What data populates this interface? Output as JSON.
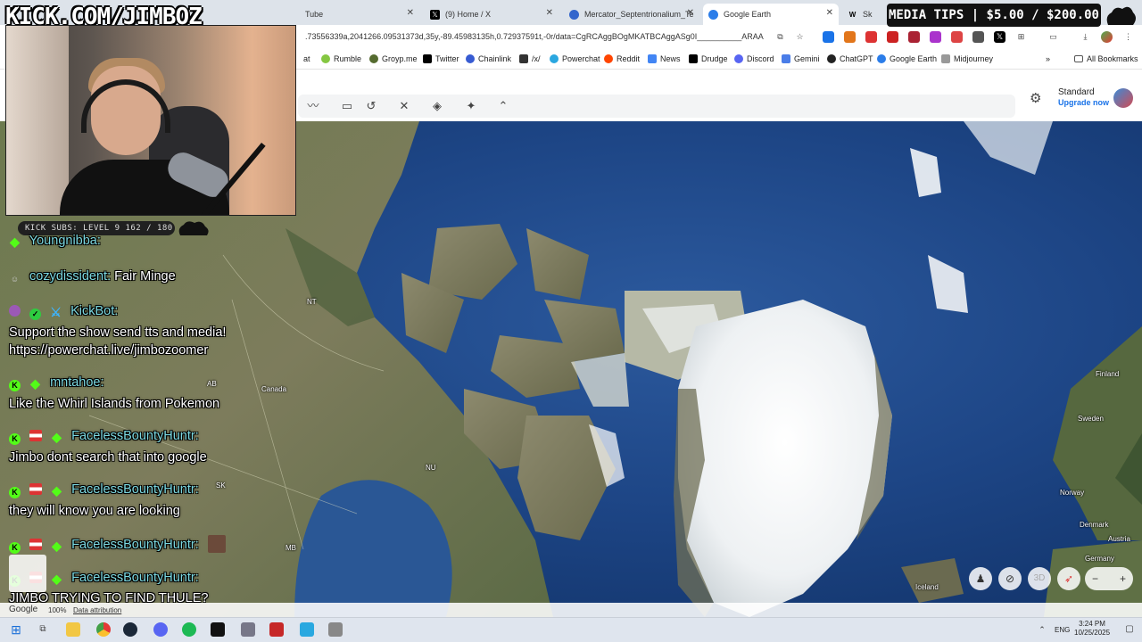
{
  "stream": {
    "logo_text": "KICK.COM/JIMBOZ",
    "subs_bar": "KICK SUBS: LEVEL 9 162 / 180",
    "media_tips": "MEDIA TIPS | $5.00 / $200.00"
  },
  "browser": {
    "tabs": [
      {
        "title": "Tube",
        "active": false
      },
      {
        "title": "(9) Home / X",
        "active": false
      },
      {
        "title": "Mercator_Septentrionalium_Te",
        "active": false
      },
      {
        "title": "Google Earth",
        "active": true
      },
      {
        "title": "Sk",
        "active": false
      }
    ],
    "url": ".73556339a,2041266.09531373d,35y,-89.45983135h,0.72937591t,-0r/data=CgRCAggBOgMKATBCAggASg0I__________ARAA",
    "bookmarks": [
      "at",
      "Rumble",
      "Groyp.me",
      "Twitter",
      "Chainlink",
      "/x/",
      "Powerchat",
      "Reddit",
      "News",
      "Drudge",
      "Discord",
      "Gemini",
      "ChatGPT",
      "Google Earth",
      "Midjourney"
    ],
    "all_bookmarks": "All Bookmarks"
  },
  "earth": {
    "map_style": "Standard",
    "upgrade": "Upgrade now",
    "labels": [
      {
        "text": "Canada"
      },
      {
        "text": "NT"
      },
      {
        "text": "AB"
      },
      {
        "text": "SK"
      },
      {
        "text": "MB"
      },
      {
        "text": "NU"
      },
      {
        "text": "Finland"
      },
      {
        "text": "Sweden"
      },
      {
        "text": "Norway"
      },
      {
        "text": "Denmark"
      },
      {
        "text": "Austria"
      },
      {
        "text": "Germany"
      },
      {
        "text": "Iceland"
      }
    ],
    "btn_3d": "3D",
    "attribution_logo": "Google",
    "zoom_level": "100%",
    "data_attribution": "Data attribution"
  },
  "chat": [
    {
      "user": "Youngnibba:",
      "message": ""
    },
    {
      "user": "cozydissident:",
      "message": "Fair Minge"
    },
    {
      "user": "KickBot:",
      "message": "Support the show send tts and media!"
    },
    {
      "user": "",
      "message": "https://powerchat.live/jimbozoomer"
    },
    {
      "user": "mntahoe:",
      "message": ""
    },
    {
      "user": "",
      "message": "Like the Whirl Islands from Pokemon"
    },
    {
      "user": "FacelessBountyHuntr:",
      "message": ""
    },
    {
      "user": "",
      "message": "Jimbo dont search that into google"
    },
    {
      "user": "FacelessBountyHuntr:",
      "message": ""
    },
    {
      "user": "",
      "message": "they will know you are looking"
    },
    {
      "user": "FacelessBountyHuntr:",
      "message": ""
    },
    {
      "user": "FacelessBountyHuntr:",
      "message": ""
    },
    {
      "user": "",
      "message": "JIMBO TRYING TO FIND THULE?"
    }
  ],
  "taskbar": {
    "language": "ENG",
    "time": "3:24 PM",
    "date": "10/25/2025"
  }
}
